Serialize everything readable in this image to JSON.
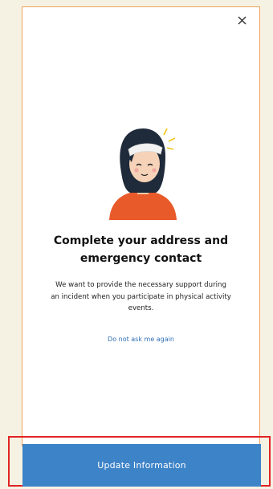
{
  "modal": {
    "title": "Complete your address and\nemergency contact",
    "description": "We want to provide the necessary support during\nan incident when you participate in physical activity\nevents.",
    "dismiss_link": "Do not ask me again",
    "close_icon": "close-icon",
    "illustration": "injured-woman-illustration"
  },
  "footer": {
    "update_label": "Update Information"
  },
  "colors": {
    "modal_border": "#f3a15a",
    "button_bg": "#3d83c8",
    "link": "#2f6fb6",
    "highlight_border": "#e02424",
    "page_bg": "#f6f2e3"
  }
}
